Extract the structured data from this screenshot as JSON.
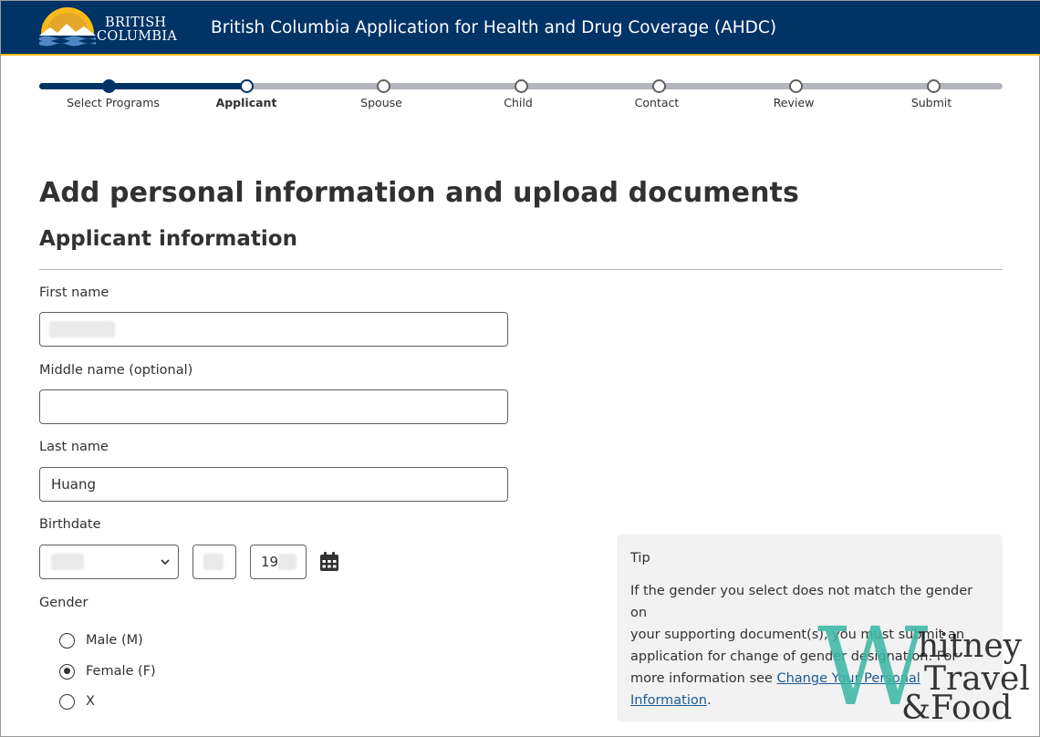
{
  "header": {
    "logo_line1": "BRITISH",
    "logo_line2": "COLUMBIA",
    "title": "British Columbia Application for Health and Drug Coverage (AHDC)"
  },
  "stepper": {
    "steps": [
      {
        "label": "Select Programs",
        "state": "done"
      },
      {
        "label": "Applicant",
        "state": "current"
      },
      {
        "label": "Spouse",
        "state": "upcoming"
      },
      {
        "label": "Child",
        "state": "upcoming"
      },
      {
        "label": "Contact",
        "state": "upcoming"
      },
      {
        "label": "Review",
        "state": "upcoming"
      },
      {
        "label": "Submit",
        "state": "upcoming"
      }
    ]
  },
  "page": {
    "title": "Add personal information and upload documents",
    "section_title": "Applicant information"
  },
  "form": {
    "first_name_label": "First name",
    "first_name_value": "",
    "middle_name_label": "Middle name (optional)",
    "middle_name_value": "",
    "last_name_label": "Last name",
    "last_name_value": "Huang",
    "birthdate_label": "Birthdate",
    "birth_month_value": "",
    "birth_day_value": "",
    "birth_year_value": "19",
    "gender_label": "Gender",
    "gender_options": [
      {
        "label": "Male (M)",
        "checked": false
      },
      {
        "label": "Female (F)",
        "checked": true
      },
      {
        "label": "X",
        "checked": false
      }
    ]
  },
  "tip": {
    "title": "Tip",
    "body_line1": "If the gender you select does not match the gender on",
    "body_line2": "your supporting document(s), you must submit an",
    "body_line3": "application for change of gender designation. For",
    "body_line4_prefix": "more information see ",
    "link_line1": "Change Your Personal",
    "link_line2": "Information",
    "body_suffix": "."
  },
  "watermark": {
    "w": "W",
    "line1": "hitney",
    "line2": "Travel",
    "line3": "&Food"
  },
  "colors": {
    "header_bg": "#003366",
    "accent_gold": "#fcba19",
    "link": "#1a5a96",
    "watermark_teal": "#3fb7a6"
  },
  "icons": {
    "logo": "bc-sun-logo",
    "calendar": "calendar-icon",
    "chevron": "chevron-down-icon"
  }
}
